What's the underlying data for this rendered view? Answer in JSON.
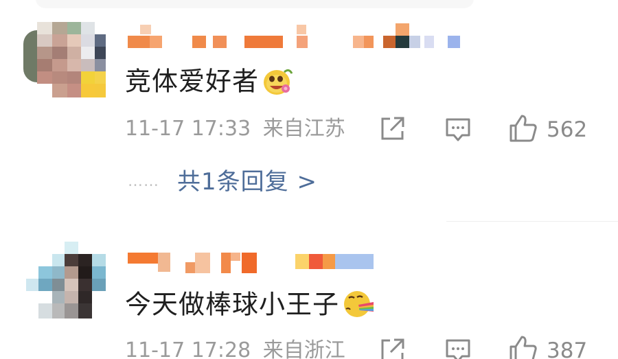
{
  "comments": [
    {
      "text": "竞体爱好者",
      "emoji": "grinning-flower-face",
      "timestamp": "11-17 17:33",
      "location": "来自江苏",
      "likes": "562",
      "reply_link": "共1条回复 >",
      "reply_dots": "……"
    },
    {
      "text": "今天做棒球小王子",
      "emoji": "rainbow-vomit-face",
      "timestamp": "11-17 17:28",
      "location": "来自浙江",
      "likes": "387"
    }
  ],
  "colors": {
    "link": "#4e6d99",
    "meta": "#9a9a9a",
    "text": "#1f1f1f",
    "blur_name": "#f07a3a"
  },
  "icons": [
    "share-icon",
    "comment-icon",
    "like-icon"
  ]
}
